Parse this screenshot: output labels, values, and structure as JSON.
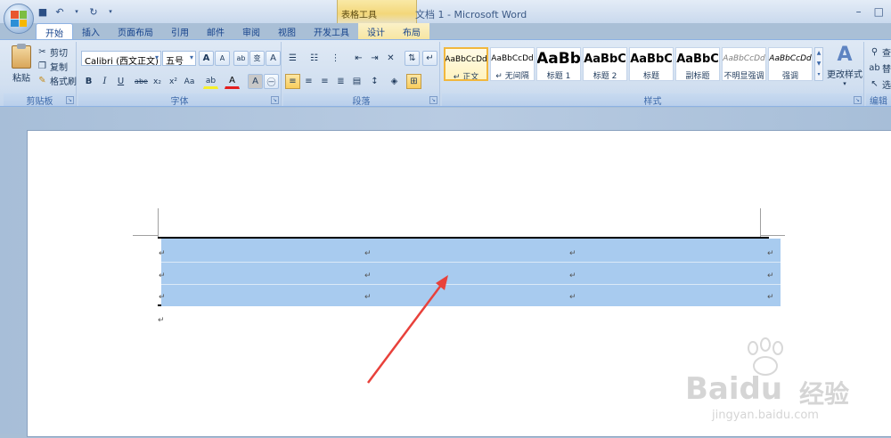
{
  "titlebar": {
    "context_tools": "表格工具",
    "doc_title": "文档 1 - Microsoft Word",
    "window_controls": [
      "–",
      "□"
    ]
  },
  "tabs": [
    "开始",
    "插入",
    "页面布局",
    "引用",
    "邮件",
    "审阅",
    "视图",
    "开发工具",
    "设计",
    "布局"
  ],
  "clipboard": {
    "paste_label": "粘贴",
    "cut_label": "剪切",
    "copy_label": "复制",
    "format_painter_label": "格式刷",
    "group_label": "剪贴板"
  },
  "font": {
    "font_name": "Calibri (西文正文)",
    "font_size": "五号",
    "group_label": "字体",
    "bold": "B",
    "italic": "I",
    "underline": "U",
    "strikethrough": "abe",
    "subscript": "x₂",
    "superscript": "x²",
    "change_case": "Aa",
    "grow": "A",
    "shrink": "A",
    "font_color": "A",
    "char_shading": "A"
  },
  "paragraph": {
    "group_label": "段落"
  },
  "styles": {
    "group_label": "样式",
    "items": [
      {
        "sample": "AaBbCcDd",
        "name": "↵ 正文"
      },
      {
        "sample": "AaBbCcDd",
        "name": "↵ 无间隔"
      },
      {
        "sample": "AaBb",
        "name": "标题 1"
      },
      {
        "sample": "AaBbC",
        "name": "标题 2"
      },
      {
        "sample": "AaBbC",
        "name": "标题"
      },
      {
        "sample": "AaBbC",
        "name": "副标题"
      },
      {
        "sample": "AaBbCcDd",
        "name": "不明显强调"
      },
      {
        "sample": "AaBbCcDd",
        "name": "强调"
      }
    ],
    "change_styles_label": "更改样式"
  },
  "editing": {
    "group_label": "编辑",
    "find": "查",
    "replace": "替",
    "select": "选"
  },
  "document": {
    "cell_mark": "↵",
    "para_mark": "↵"
  },
  "watermark": {
    "brand": "Baidu",
    "brand_cn": "经验",
    "url": "jingyan.baidu.com"
  },
  "colors": {
    "table_highlight": "#a8cbef",
    "arrow": "#e8413b"
  }
}
